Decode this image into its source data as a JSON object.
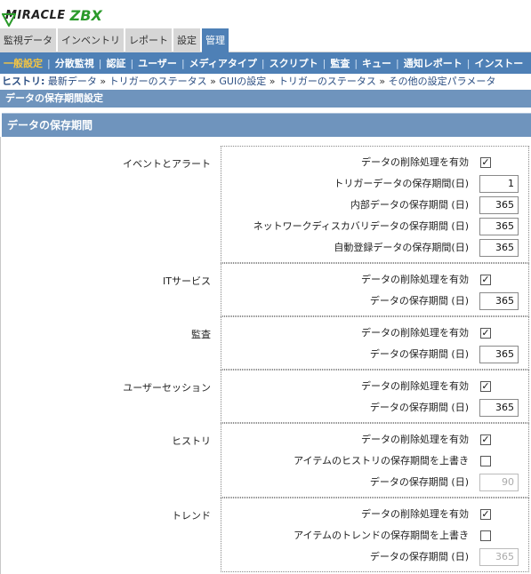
{
  "logo": {
    "brand": "MIRACLE",
    "brand2": "ZBX"
  },
  "main_tabs": [
    {
      "label": "監視データ",
      "active": false
    },
    {
      "label": "インベントリ",
      "active": false
    },
    {
      "label": "レポート",
      "active": false
    },
    {
      "label": "設定",
      "active": false
    },
    {
      "label": "管理",
      "active": true
    }
  ],
  "sub_menu": [
    {
      "label": "一般設定",
      "active": true
    },
    {
      "label": "分散監視",
      "active": false
    },
    {
      "label": "認証",
      "active": false
    },
    {
      "label": "ユーザー",
      "active": false
    },
    {
      "label": "メディアタイプ",
      "active": false
    },
    {
      "label": "スクリプト",
      "active": false
    },
    {
      "label": "監査",
      "active": false
    },
    {
      "label": "キュー",
      "active": false
    },
    {
      "label": "通知レポート",
      "active": false
    },
    {
      "label": "インストー",
      "active": false
    }
  ],
  "breadcrumb": {
    "label": "ヒストリ:",
    "items": [
      "最新データ",
      "トリガーのステータス",
      "GUIの設定",
      "トリガーのステータス",
      "その他の設定パラメータ"
    ]
  },
  "page_title": "データの保存期間設定",
  "section_title": "データの保存期間",
  "groups": [
    {
      "label": "イベントとアラート",
      "rows": [
        {
          "label": "データの削除処理を有効",
          "type": "checkbox",
          "checked": true
        },
        {
          "label": "トリガーデータの保存期間(日)",
          "type": "number",
          "value": "1",
          "disabled": false
        },
        {
          "label": "内部データの保存期間 (日)",
          "type": "number",
          "value": "365",
          "disabled": false
        },
        {
          "label": "ネットワークディスカバリデータの保存期間 (日)",
          "type": "number",
          "value": "365",
          "disabled": false
        },
        {
          "label": "自動登録データの保存期間(日)",
          "type": "number",
          "value": "365",
          "disabled": false
        }
      ]
    },
    {
      "label": "ITサービス",
      "rows": [
        {
          "label": "データの削除処理を有効",
          "type": "checkbox",
          "checked": true
        },
        {
          "label": "データの保存期間 (日)",
          "type": "number",
          "value": "365",
          "disabled": false
        }
      ]
    },
    {
      "label": "監査",
      "rows": [
        {
          "label": "データの削除処理を有効",
          "type": "checkbox",
          "checked": true
        },
        {
          "label": "データの保存期間 (日)",
          "type": "number",
          "value": "365",
          "disabled": false
        }
      ]
    },
    {
      "label": "ユーザーセッション",
      "rows": [
        {
          "label": "データの削除処理を有効",
          "type": "checkbox",
          "checked": true
        },
        {
          "label": "データの保存期間 (日)",
          "type": "number",
          "value": "365",
          "disabled": false
        }
      ]
    },
    {
      "label": "ヒストリ",
      "rows": [
        {
          "label": "データの削除処理を有効",
          "type": "checkbox",
          "checked": true
        },
        {
          "label": "アイテムのヒストリの保存期間を上書き",
          "type": "checkbox",
          "checked": false
        },
        {
          "label": "データの保存期間 (日)",
          "type": "number",
          "value": "90",
          "disabled": true
        }
      ]
    },
    {
      "label": "トレンド",
      "rows": [
        {
          "label": "データの削除処理を有効",
          "type": "checkbox",
          "checked": true
        },
        {
          "label": "アイテムのトレンドの保存期間を上書き",
          "type": "checkbox",
          "checked": false
        },
        {
          "label": "データの保存期間 (日)",
          "type": "number",
          "value": "365",
          "disabled": true
        }
      ]
    }
  ]
}
